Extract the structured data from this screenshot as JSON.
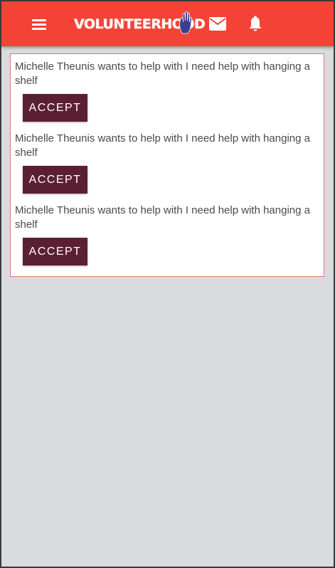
{
  "header": {
    "logo_text": "VOLUNTEERHOOD",
    "icons": {
      "menu": "menu-icon",
      "mail": "mail-icon",
      "bell": "bell-icon",
      "hand": "hand-icon"
    },
    "colors": {
      "bar": "#f44336",
      "hand": "#3f3f8f"
    }
  },
  "requests": [
    {
      "message": "Michelle Theunis wants to help with I need help with hanging a shelf",
      "accept_label": "ACCEPT"
    },
    {
      "message": "Michelle Theunis wants to help with I need help with hanging a shelf",
      "accept_label": "ACCEPT"
    },
    {
      "message": "Michelle Theunis wants to help with I need help with hanging a shelf",
      "accept_label": "ACCEPT"
    }
  ],
  "colors": {
    "accept_button": "#5b1f33",
    "panel_border": "#e57373",
    "background": "#dadbdf"
  }
}
